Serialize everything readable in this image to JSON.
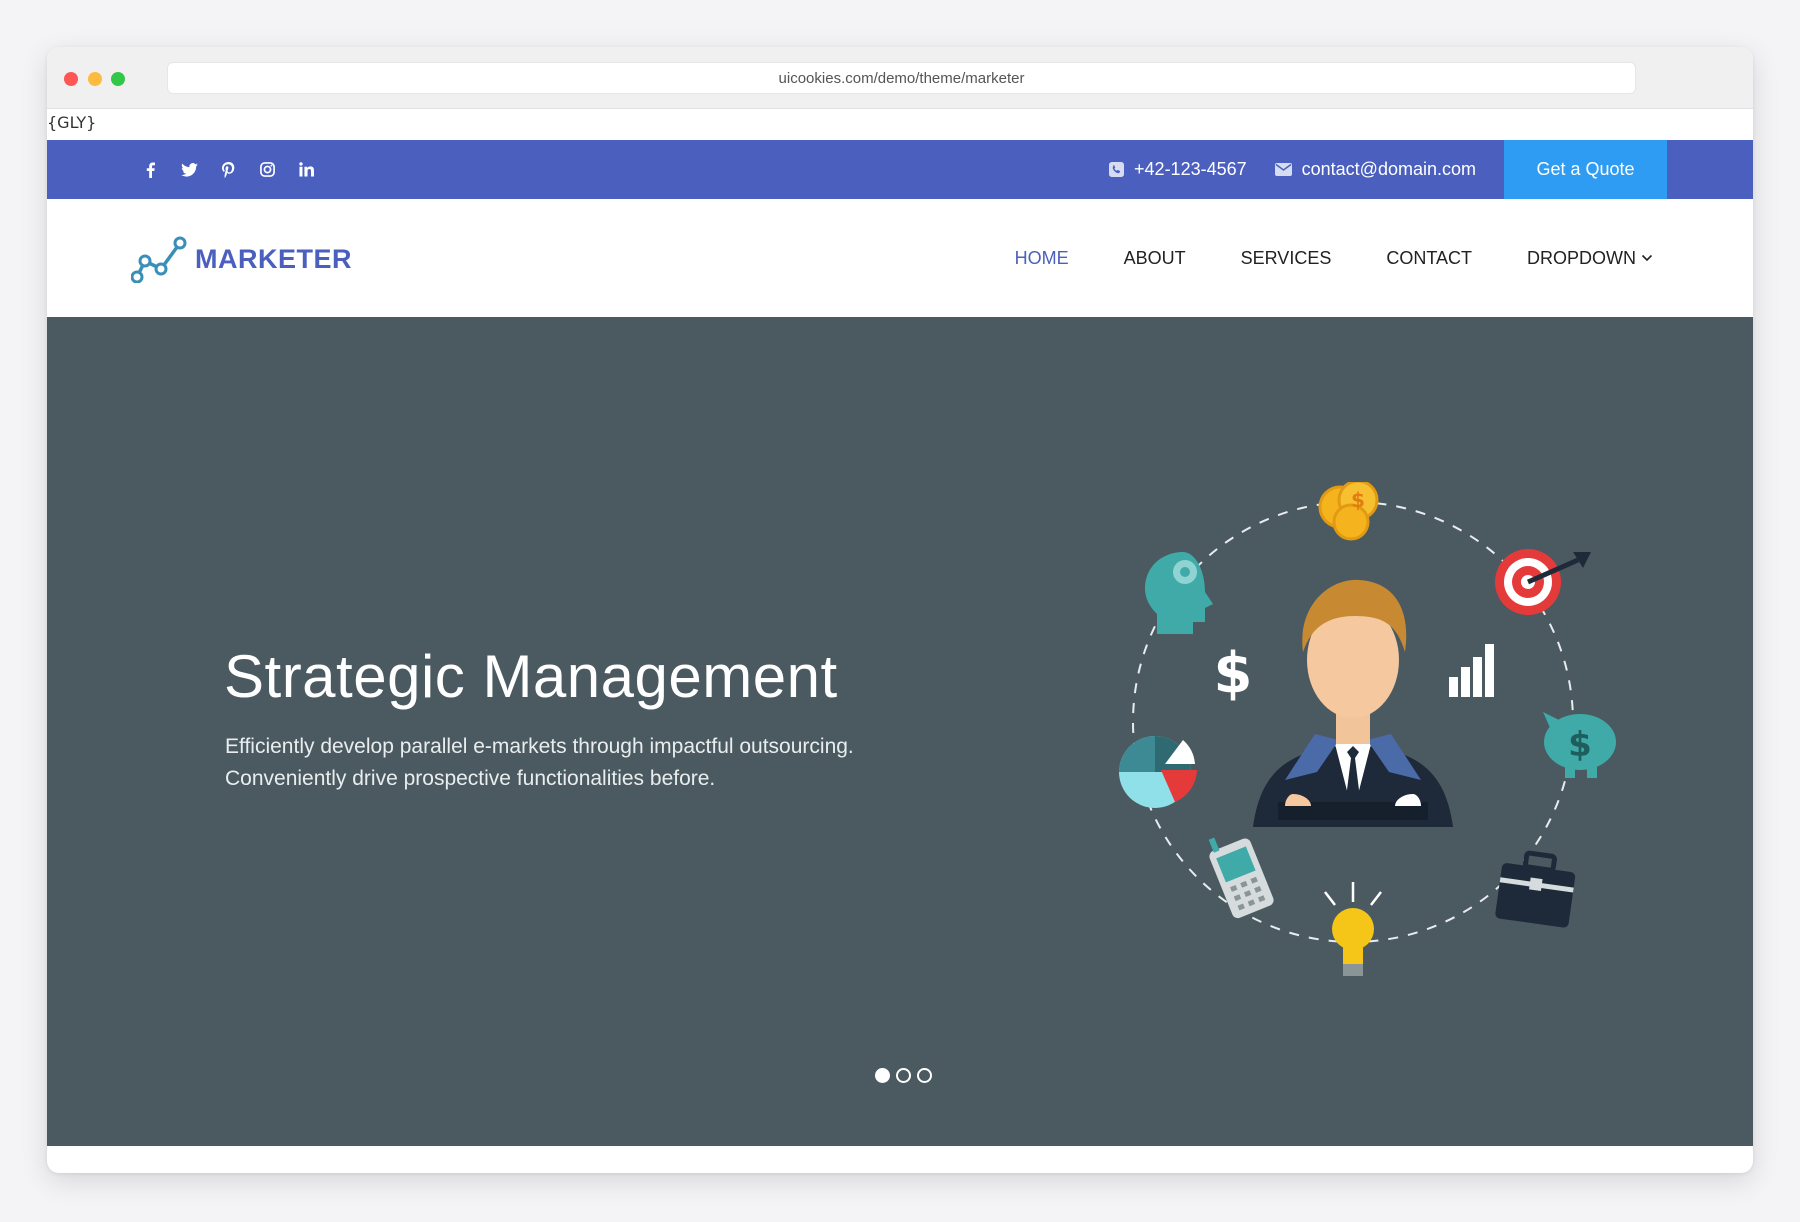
{
  "browser": {
    "url": "uicookies.com/demo/theme/marketer"
  },
  "glyph_note": "{GLY}",
  "topbar": {
    "social": [
      {
        "icon": "facebook-icon"
      },
      {
        "icon": "twitter-icon"
      },
      {
        "icon": "pinterest-icon"
      },
      {
        "icon": "instagram-icon"
      },
      {
        "icon": "linkedin-icon"
      }
    ],
    "phone": "+42-123-4567",
    "email": "contact@domain.com",
    "quote_button": "Get a Quote"
  },
  "nav": {
    "logo_text": "MARKETER",
    "items": [
      {
        "label": "HOME",
        "active": true
      },
      {
        "label": "ABOUT"
      },
      {
        "label": "SERVICES"
      },
      {
        "label": "CONTACT"
      },
      {
        "label": "DROPDOWN"
      }
    ]
  },
  "hero": {
    "title": "Strategic Management",
    "text_line1": "Efficiently develop parallel e-markets through impactful outsourcing.",
    "text_line2": "Conveniently drive prospective functionalities before.",
    "slides": 3,
    "active_slide": 0
  },
  "colors": {
    "brand": "#4a5fbe",
    "quote_button": "#2e9cf3",
    "hero_bg": "#4b5a60"
  }
}
